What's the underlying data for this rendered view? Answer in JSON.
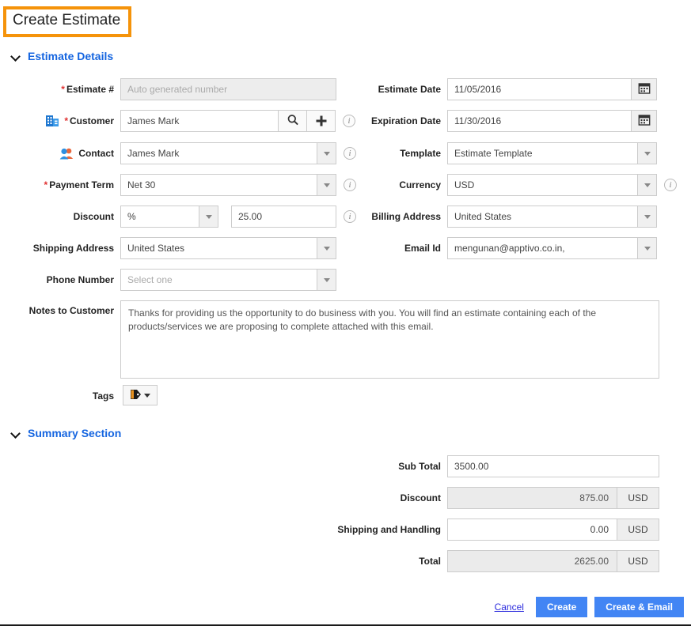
{
  "page": {
    "title": "Create Estimate"
  },
  "sections": {
    "details": {
      "label": "Estimate Details"
    },
    "summary": {
      "label": "Summary Section"
    }
  },
  "left_fields": {
    "estimate_number": {
      "label": "Estimate #",
      "required": true,
      "placeholder": "Auto generated number",
      "value": ""
    },
    "customer": {
      "label": "Customer",
      "required": true,
      "value": "James Mark",
      "icon": "building-icon",
      "search_icon": "search-icon",
      "add_icon": "plus-icon",
      "info_icon": "info-icon"
    },
    "contact": {
      "label": "Contact",
      "required": false,
      "value": "James Mark",
      "icon": "people-icon",
      "info_icon": "info-icon"
    },
    "payment_term": {
      "label": "Payment Term",
      "required": true,
      "value": "Net 30",
      "info_icon": "info-icon"
    },
    "discount": {
      "label": "Discount",
      "type_value": "%",
      "amount_value": "25.00",
      "info_icon": "info-icon"
    },
    "shipping_address": {
      "label": "Shipping Address",
      "value": "United States"
    },
    "phone_number": {
      "label": "Phone Number",
      "value": "",
      "placeholder": "Select one"
    },
    "notes": {
      "label": "Notes to Customer",
      "value": "Thanks for providing us the opportunity to do business with you. You will find an estimate containing each of the products/services we are proposing to complete attached with this email."
    },
    "tags": {
      "label": "Tags",
      "icon": "tag-icon",
      "caret": "chevron-down-icon"
    }
  },
  "right_fields": {
    "estimate_date": {
      "label": "Estimate Date",
      "value": "11/05/2016",
      "icon": "calendar-icon"
    },
    "expiration_date": {
      "label": "Expiration Date",
      "value": "11/30/2016",
      "icon": "calendar-icon"
    },
    "template": {
      "label": "Template",
      "value": "Estimate Template"
    },
    "currency": {
      "label": "Currency",
      "value": "USD",
      "info_icon": "info-icon"
    },
    "billing_address": {
      "label": "Billing Address",
      "value": "United States"
    },
    "email_id": {
      "label": "Email Id",
      "value": "mengunan@apptivo.co.in,"
    }
  },
  "summary": {
    "sub_total": {
      "label": "Sub Total",
      "value": "3500.00",
      "readonly": false,
      "suffix": ""
    },
    "discount": {
      "label": "Discount",
      "value": "875.00",
      "readonly": true,
      "suffix": "USD"
    },
    "shipping_handling": {
      "label": "Shipping and Handling",
      "value": "0.00",
      "readonly": false,
      "suffix": "USD"
    },
    "total": {
      "label": "Total",
      "value": "2625.00",
      "readonly": true,
      "suffix": "USD"
    }
  },
  "footer": {
    "cancel_label": "Cancel",
    "create_label": "Create",
    "create_email_label": "Create & Email"
  },
  "colors": {
    "title_highlight": "#F5930A",
    "section_header": "#1565e0",
    "primary_button": "#4285f4",
    "required_star": "#e03131",
    "link": "#2b2bdd"
  }
}
